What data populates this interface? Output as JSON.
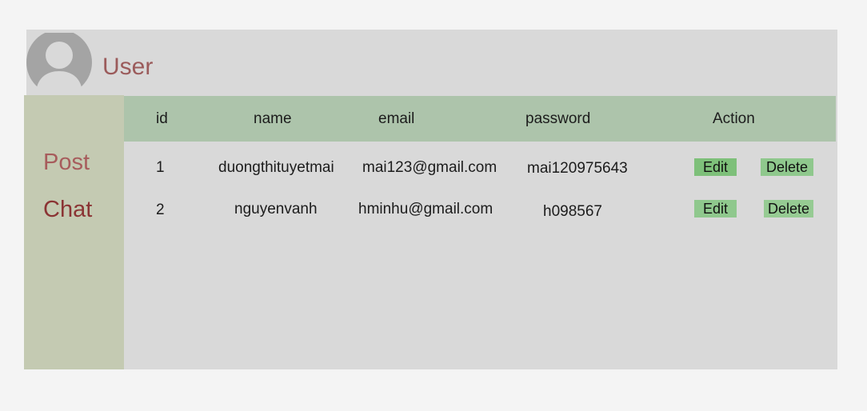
{
  "header": {
    "title": "User"
  },
  "sidebar": {
    "items": [
      {
        "label": "Post"
      },
      {
        "label": "Chat"
      }
    ]
  },
  "table": {
    "columns": [
      "id",
      "name",
      "email",
      "password",
      "Action"
    ],
    "rows": [
      {
        "id": "1",
        "name": "duongthituyetmai",
        "email": "mai123@gmail.com",
        "password": "mai120975643",
        "edit_label": "Edit",
        "delete_label": "Delete"
      },
      {
        "id": "2",
        "name": "nguyenvanh",
        "email": "hminhu@gmail.com",
        "password": "h098567",
        "edit_label": "Edit",
        "delete_label": "Delete"
      }
    ]
  },
  "colors": {
    "page_background": "#f4f4f4",
    "panel_background": "#d9d9d9",
    "sidebar_background": "#c4cab2",
    "table_header_background": "#adc4ab",
    "title_color": "#9b5b5b",
    "button_green": "#7ec07a"
  }
}
